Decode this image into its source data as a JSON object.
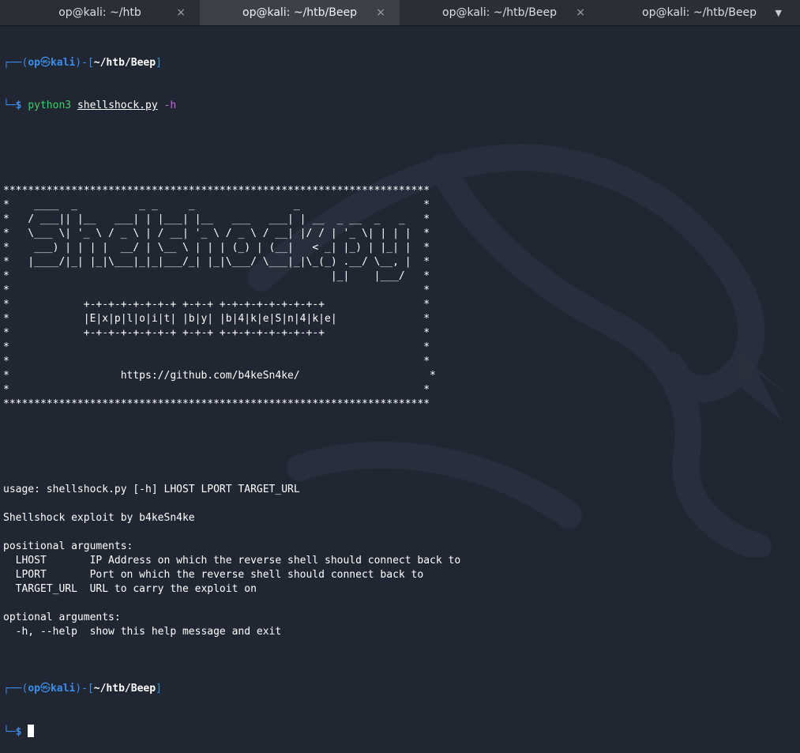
{
  "tabs": [
    {
      "title": "op@kali: ~/htb",
      "close": "×"
    },
    {
      "title": "op@kali: ~/htb/Beep",
      "close": "×"
    },
    {
      "title": "op@kali: ~/htb/Beep",
      "close": "×"
    },
    {
      "title": "op@kali: ~/htb/Beep",
      "menu": "▼"
    }
  ],
  "prompt": {
    "top_left": "┌──(",
    "user": "op",
    "at": "㉿",
    "host": "kali",
    "mid": ")-[",
    "path": "~/htb/Beep",
    "end": "]",
    "bottom_left": "└─",
    "dollar": "$"
  },
  "command": {
    "program": "python3",
    "script": "shellshock.py",
    "flag": "-h"
  },
  "banner": [
    "*********************************************************************",
    "*    ____  _          _ _     _                _                    *",
    "*   / ___|| |__   ___| | |___| |__   ___   ___| | __  _ __  _   _   *",
    "*   \\___ \\| '_ \\ / _ \\ | / __| '_ \\ / _ \\ / __| |/ / | '_ \\| | | |  *",
    "*    ___) | | | |  __/ | \\__ \\ | | | (_) | (__|   < _| |_) | |_| |  *",
    "*   |____/|_| |_|\\___|_|_|___/_| |_|\\___/ \\___|_|\\_(_) .__/ \\__, |  *",
    "*                                                    |_|    |___/   *",
    "*                                                                   *",
    "*            +-+-+-+-+-+-+-+ +-+-+ +-+-+-+-+-+-+-+-+                *",
    "*            |E|x|p|l|o|i|t| |b|y| |b|4|k|e|S|n|4|k|e|              *",
    "*            +-+-+-+-+-+-+-+ +-+-+ +-+-+-+-+-+-+-+-+                *",
    "*                                                                   *",
    "*                                                                   *",
    "*                  https://github.com/b4keSn4ke/                     *",
    "*                                                                   *",
    "*********************************************************************"
  ],
  "output": [
    "",
    "",
    "",
    "usage: shellshock.py [-h] LHOST LPORT TARGET_URL",
    "",
    "Shellshock exploit by b4keSn4ke",
    "",
    "positional arguments:",
    "  LHOST       IP Address on which the reverse shell should connect back to",
    "  LPORT       Port on which the reverse shell should connect back to",
    "  TARGET_URL  URL to carry the exploit on",
    "",
    "optional arguments:",
    "  -h, --help  show this help message and exit",
    ""
  ],
  "colors": {
    "background": "#202632",
    "prompt_frame": "#3b8eea",
    "command": "#3fd06b",
    "flag": "#c06cd9"
  }
}
